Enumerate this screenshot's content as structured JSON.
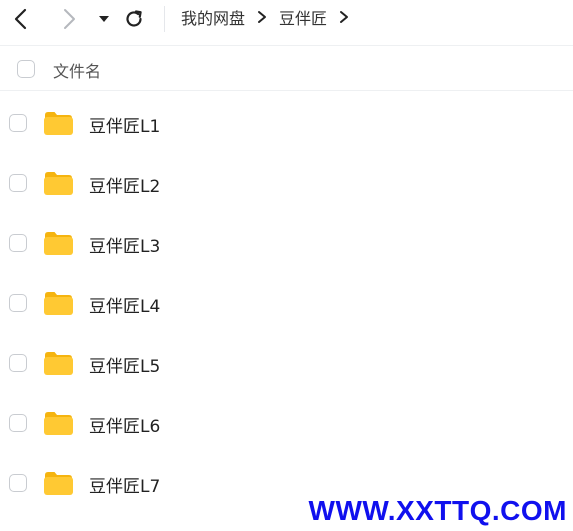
{
  "toolbar": {
    "back_icon": "chevron-left-icon",
    "forward_icon": "chevron-right-icon",
    "dropdown_icon": "caret-down-icon",
    "refresh_icon": "refresh-icon"
  },
  "breadcrumb": {
    "items": [
      "我的网盘",
      "豆伴匠"
    ],
    "separator_icon": "chevron-right-icon"
  },
  "list": {
    "header": {
      "name_label": "文件名"
    },
    "items": [
      {
        "name": "豆伴匠L1",
        "icon": "folder-icon"
      },
      {
        "name": "豆伴匠L2",
        "icon": "folder-icon"
      },
      {
        "name": "豆伴匠L3",
        "icon": "folder-icon"
      },
      {
        "name": "豆伴匠L4",
        "icon": "folder-icon"
      },
      {
        "name": "豆伴匠L5",
        "icon": "folder-icon"
      },
      {
        "name": "豆伴匠L6",
        "icon": "folder-icon"
      },
      {
        "name": "豆伴匠L7",
        "icon": "folder-icon"
      }
    ]
  },
  "watermark": {
    "text": "WWW.XXTTQ.COM"
  },
  "colors": {
    "folder": "#ffc933",
    "folder_back": "#f5b40f",
    "watermark": "#1010ee",
    "divider": "#eef0f2"
  }
}
